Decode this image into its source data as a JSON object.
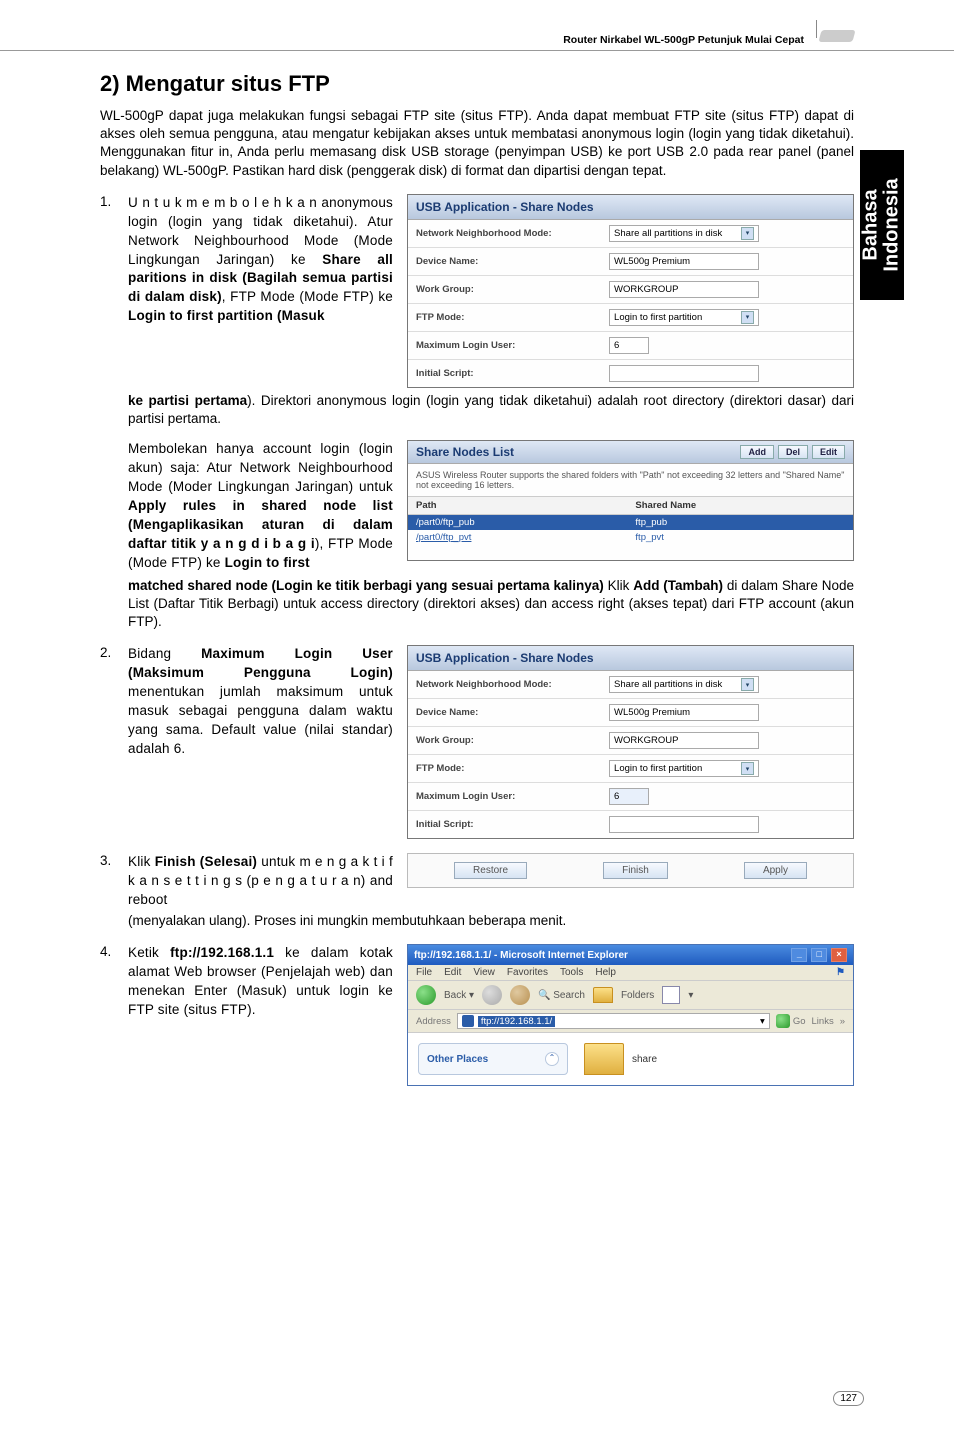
{
  "header": {
    "text": "Router Nirkabel WL-500gP   Petunjuk Mulai Cepat"
  },
  "side_tab": {
    "line1": "Bahasa",
    "line2": "Indonesia"
  },
  "section_title": "2) Mengatur situs FTP",
  "intro": "WL-500gP dapat juga melakukan fungsi sebagai FTP site (situs FTP). Anda dapat membuat FTP site (situs FTP) dapat di akses oleh semua pengguna, atau mengatur kebijakan akses untuk membatasi anonymous login (login yang tidak diketahui). Menggunakan fitur in, Anda perlu memasang disk USB storage (penyimpan USB) ke port USB 2.0 pada rear panel (panel belakang) WL-500gP.  Pastikan hard disk (penggerak disk) di format dan dipartisi dengan tepat.",
  "step1": {
    "num": "1.",
    "left": "U n t u k  m e m b o l e h k a n anonymous login (login yang tidak diketahui). Atur Network Neighbourhood Mode (Mode Lingkungan Jaringan) ke <b>Share all paritions in disk (Bagilah semua partisi di dalam disk)</b>, FTP Mode (Mode FTP) ke <b>Login to first partition (Masuk</b>",
    "after1": "<b>ke partisi pertama</b>). Direktori anonymous login (login yang tidak diketahui) adalah root directory (direktori dasar) dari partisi pertama.",
    "left2": "Membolekan hanya account login (login akun) saja: Atur Network Neighbourhood Mode (Moder Lingkungan Jaringan) untuk <b>Apply rules in shared node list (Mengaplikasikan aturan di dalam daftar titik y a n g  d i b a g i</b>), FTP Mode (Mode FTP) ke <b>Login to first</b>",
    "after2": "<b>matched shared node (Login ke titik berbagi yang sesuai pertama kalinya)</b> Klik <b>Add (Tambah)</b> di dalam Share Node List (Daftar Titik Berbagi) untuk access directory (direktori akses) dan access right (akses tepat) dari FTP account (akun FTP)."
  },
  "panel1": {
    "title": "USB Application - Share Nodes",
    "rows": {
      "nn_mode_k": "Network Neighborhood Mode:",
      "nn_mode_v": "Share all partitions in disk",
      "dev_k": "Device Name:",
      "dev_v": "WL500g Premium",
      "wg_k": "Work Group:",
      "wg_v": "WORKGROUP",
      "ftp_k": "FTP Mode:",
      "ftp_v": "Login to first partition",
      "max_k": "Maximum Login User:",
      "max_v": "6",
      "init_k": "Initial Script:",
      "init_v": ""
    }
  },
  "share_list": {
    "title": "Share Nodes List",
    "btns": {
      "add": "Add",
      "del": "Del",
      "edit": "Edit"
    },
    "desc": "ASUS Wireless Router supports the shared folders with \"Path\" not exceeding 32 letters and \"Shared Name\" not exceeding 16 letters.",
    "cols": {
      "path": "Path",
      "shared": "Shared Name"
    },
    "rows": [
      {
        "path": "/part0/ftp_pub",
        "shared": "ftp_pub",
        "hl": true
      },
      {
        "path": "/part0/ftp_pvt",
        "shared": "ftp_pvt",
        "hl": false
      }
    ]
  },
  "step2": {
    "num": "2.",
    "left": "Bidang <b>Maximum Login User (Maksimum Pengguna Login)</b> menentukan jumlah maksimum untuk masuk sebagai pengguna dalam  waktu  yang  sama. Default value (nilai standar) adalah 6."
  },
  "panel2": {
    "title": "USB Application - Share Nodes",
    "rows": {
      "nn_mode_k": "Network Neighborhood Mode:",
      "nn_mode_v": "Share all partitions in disk",
      "dev_k": "Device Name:",
      "dev_v": "WL500g Premium",
      "wg_k": "Work Group:",
      "wg_v": "WORKGROUP",
      "ftp_k": "FTP Mode:",
      "ftp_v": "Login to first partition",
      "max_k": "Maximum Login User:",
      "max_v": "6",
      "init_k": "Initial Script:",
      "init_v": ""
    }
  },
  "step3": {
    "num": "3.",
    "left": "Klik <b>Finish (Selesai)</b> untuk m e n g a k t i f k a n  s e t t i n g s (p e n g a t u r a n)  and  reboot",
    "after": "(menyalakan ulang). Proses ini mungkin membutuhkaan beberapa menit.",
    "btns": {
      "restore": "Restore",
      "finish": "Finish",
      "apply": "Apply"
    }
  },
  "step4": {
    "num": "4.",
    "left": "Ketik <b>ftp://192.168.1.1</b> ke dalam kotak alamat Web browser (Penjelajah web) dan menekan Enter (Masuk) untuk login ke FTP site (situs FTP)."
  },
  "ie": {
    "title": "ftp://192.168.1.1/ - Microsoft Internet Explorer",
    "menu": [
      "File",
      "Edit",
      "View",
      "Favorites",
      "Tools",
      "Help"
    ],
    "tool": {
      "search": "Search",
      "folders": "Folders"
    },
    "addr_label": "Address",
    "url": "ftp://192.168.1.1/",
    "go": "Go",
    "links": "Links",
    "side": "Other Places",
    "item": "share"
  },
  "page_num": "127"
}
